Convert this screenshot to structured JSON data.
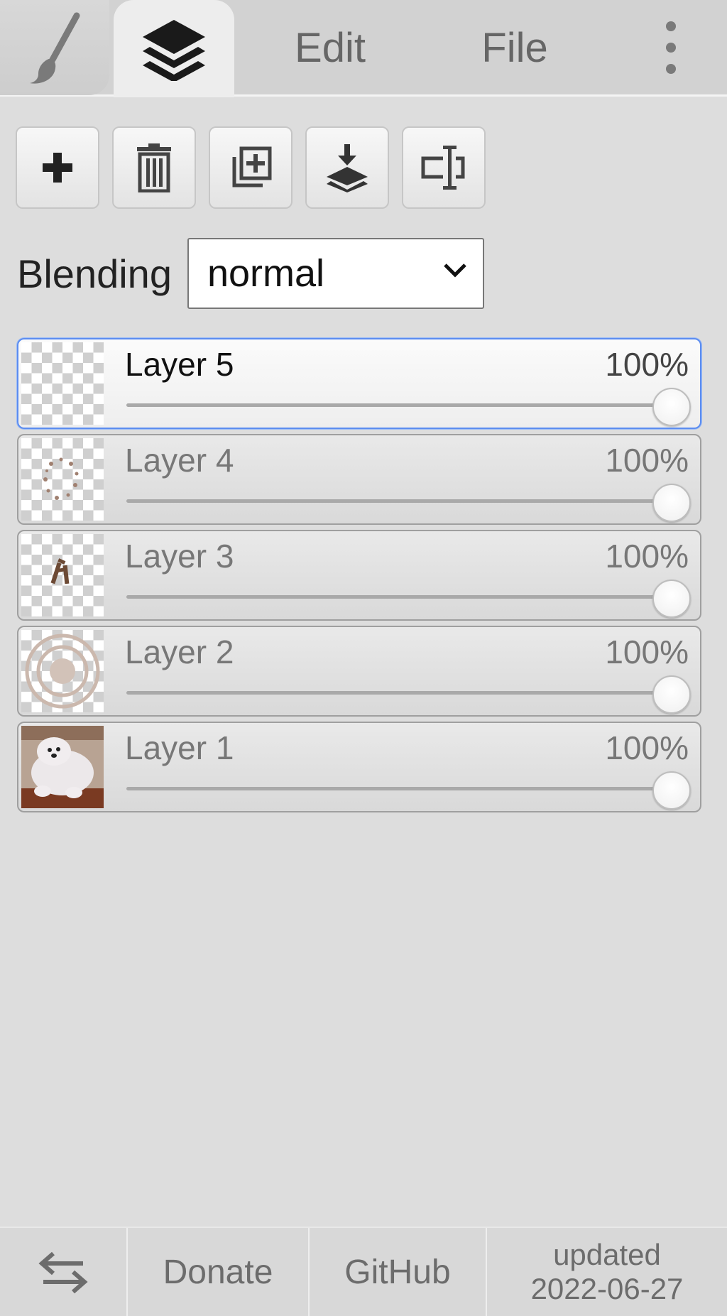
{
  "tabs": {
    "brush_icon": "brush-icon",
    "layers_icon": "layers-icon",
    "edit_label": "Edit",
    "file_label": "File",
    "more_icon": "more-vertical-icon"
  },
  "toolbar": {
    "buttons": [
      {
        "name": "add-layer",
        "icon": "plus-icon"
      },
      {
        "name": "delete-layer",
        "icon": "trash-icon"
      },
      {
        "name": "duplicate-layer",
        "icon": "duplicate-icon"
      },
      {
        "name": "merge-down",
        "icon": "merge-down-icon"
      },
      {
        "name": "rename-layer",
        "icon": "rename-icon"
      }
    ]
  },
  "blending": {
    "label": "Blending",
    "value": "normal"
  },
  "layers": [
    {
      "name": "Layer 5",
      "opacity": "100%",
      "opacity_value": 1.0,
      "active": true
    },
    {
      "name": "Layer 4",
      "opacity": "100%",
      "opacity_value": 1.0,
      "active": false
    },
    {
      "name": "Layer 3",
      "opacity": "100%",
      "opacity_value": 1.0,
      "active": false
    },
    {
      "name": "Layer 2",
      "opacity": "100%",
      "opacity_value": 1.0,
      "active": false
    },
    {
      "name": "Layer 1",
      "opacity": "100%",
      "opacity_value": 1.0,
      "active": false
    }
  ],
  "footer": {
    "swap_icon": "swap-arrows-icon",
    "donate": "Donate",
    "github": "GitHub",
    "updated_line1": "updated",
    "updated_line2": "2022-06-27"
  },
  "colors": {
    "active_border": "#5b8cf0",
    "panel_bg": "#dddddd"
  }
}
